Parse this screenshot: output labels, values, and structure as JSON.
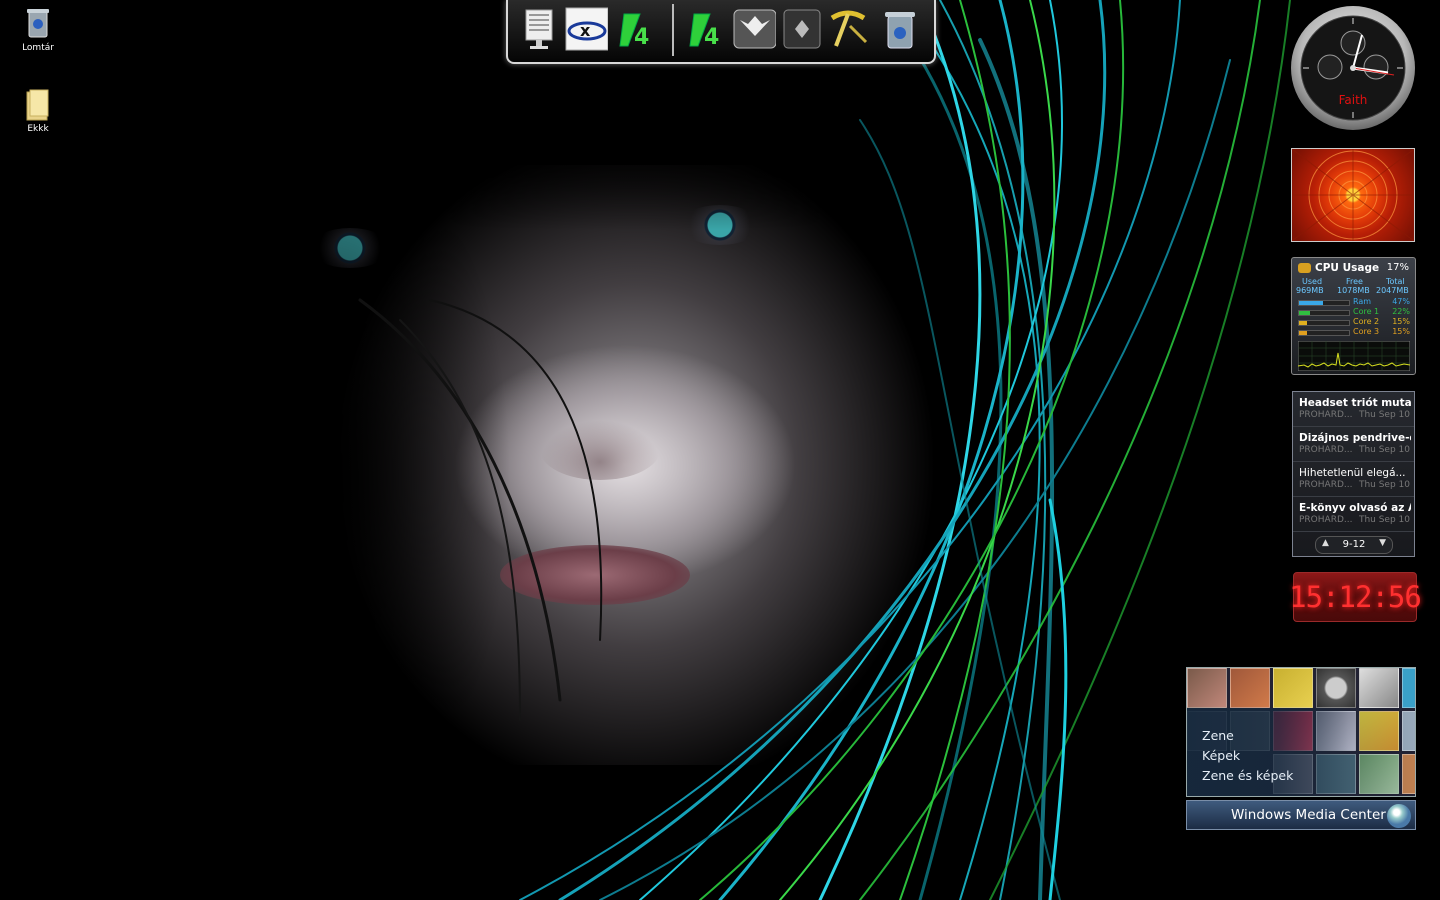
{
  "desktop": {
    "icons": [
      {
        "name": "Lomtár",
        "type": "recycle-bin"
      },
      {
        "name": "Ekkk",
        "type": "folder"
      }
    ]
  },
  "dock": {
    "items": [
      {
        "icon": "computer-icon"
      },
      {
        "icon": "xion-icon"
      },
      {
        "icon": "winamp-green-icon"
      },
      {
        "icon": "winamp-green-icon"
      },
      {
        "icon": "dragon-emblem-icon"
      },
      {
        "icon": "diamond-icon"
      },
      {
        "icon": "pickaxe-icon"
      },
      {
        "icon": "recycle-bin-icon"
      }
    ]
  },
  "gadgets": {
    "clock": {
      "name": "Faith"
    },
    "cpu": {
      "title": "CPU Usage",
      "percent": "17%",
      "mem_headers": {
        "used": "Used",
        "free": "Free",
        "total": "Total"
      },
      "mem_values": {
        "used": "969MB",
        "free": "1078MB",
        "total": "2047MB"
      },
      "meters": [
        {
          "label": "Ram",
          "percent": "47%",
          "level": 0.47,
          "color": "#3aa8e8"
        },
        {
          "label": "Core 1",
          "percent": "22%",
          "level": 0.22,
          "color": "#30c040"
        },
        {
          "label": "Core 2",
          "percent": "15%",
          "level": 0.15,
          "color": "#e0b020"
        },
        {
          "label": "Core 3",
          "percent": "15%",
          "level": 0.15,
          "color": "#e0a020"
        }
      ]
    },
    "news": {
      "items": [
        {
          "title": "Headset triót mutato...",
          "source": "PROHARD...",
          "date": "Thu Sep 10"
        },
        {
          "title": "Dizájnos pendrive-ok",
          "source": "PROHARD...",
          "date": "Thu Sep 10"
        },
        {
          "title": "Hihetetlenül elegá...",
          "source": "PROHARD...",
          "date": "Thu Sep 10"
        },
        {
          "title": "E-könyv olvasó az As...",
          "source": "PROHARD...",
          "date": "Thu Sep 10"
        }
      ],
      "pager": "9-12"
    },
    "digital_clock": {
      "time": "15:12:56"
    },
    "media_center": {
      "menu": [
        "Zene",
        "Képek",
        "Zene és képek"
      ],
      "title": "Windows Media Center"
    }
  }
}
